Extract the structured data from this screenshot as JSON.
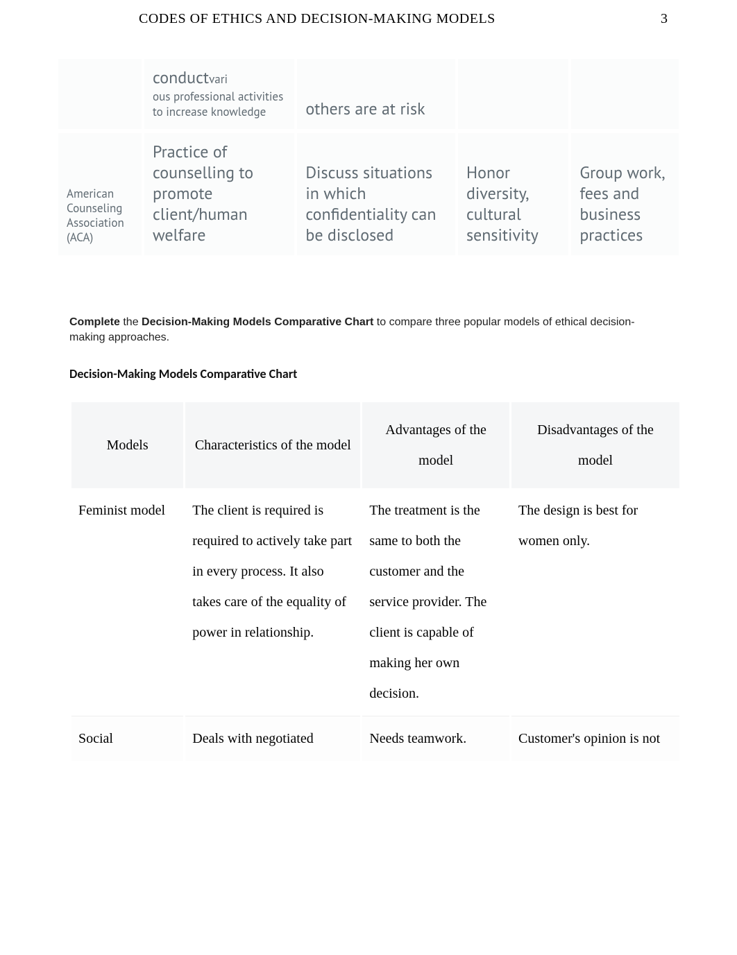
{
  "header": {
    "title": "CODES OF ETHICS AND DECISION-MAKING MODELS",
    "page_number": "3"
  },
  "table1": {
    "rows": [
      {
        "col0": "",
        "col1_big": "conduct",
        "col1_big_suffix": "vari",
        "col1_small": "ous professional activities to increase knowledge",
        "col2": "others are at risk",
        "col3": "",
        "col4": ""
      },
      {
        "col0": "American Counseling Association (ACA)",
        "col1": "Practice of counselling to promote client/human welfare",
        "col2": "Discuss situations in which confidentiality can be disclosed",
        "col3": "Honor diversity, cultural sensitivity",
        "col4": "Group work, fees and business practices"
      }
    ]
  },
  "paragraph": {
    "prefix_bold": "Complete",
    "mid": " the ",
    "mid_bold": "Decision-Making Models Comparative Chart",
    "suffix": " to compare three popular models of ethical decision-making approaches."
  },
  "subhead": "Decision-Making Models Comparative Chart",
  "table2": {
    "headers": {
      "models": "Models",
      "characteristics": "Characteristics of the model",
      "advantages": "Advantages of the model",
      "disadvantages": "Disadvantages of the model"
    },
    "rows": [
      {
        "model": "Feminist model",
        "characteristics": "The client is required is required to actively take part in every process. It also takes care of the equality of power in relationship.",
        "advantages": "The treatment is the same to both the customer and the service provider. The client is capable of making her own decision.",
        "disadvantages": "The design is best for women only."
      },
      {
        "model": "Social",
        "characteristics": "Deals with negotiated",
        "advantages": "Needs teamwork.",
        "disadvantages": "Customer's opinion is not"
      }
    ]
  }
}
